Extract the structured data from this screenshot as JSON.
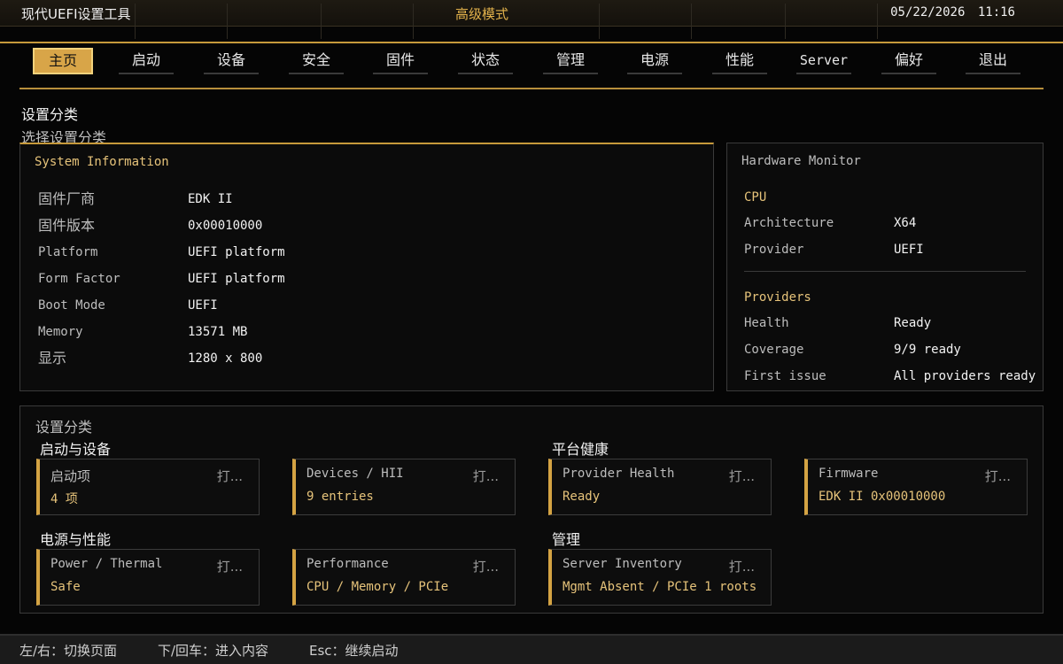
{
  "header": {
    "app_title": "现代UEFI设置工具",
    "mode": "高级模式",
    "date": "05/22/2026",
    "time": "11:16"
  },
  "nav": {
    "tabs": [
      "主页",
      "启动",
      "设备",
      "安全",
      "固件",
      "状态",
      "管理",
      "电源",
      "性能",
      "Server",
      "偏好",
      "退出"
    ],
    "active": "主页"
  },
  "page": {
    "title": "设置分类",
    "subtitle": "选择设置分类"
  },
  "system_info": {
    "title": "System Information",
    "rows": [
      {
        "key": "固件厂商",
        "value": "EDK II"
      },
      {
        "key": "固件版本",
        "value": "0x00010000"
      },
      {
        "key": "Platform",
        "value": "UEFI platform"
      },
      {
        "key": "Form Factor",
        "value": "UEFI platform"
      },
      {
        "key": "Boot Mode",
        "value": "UEFI"
      },
      {
        "key": "Memory",
        "value": "13571 MB"
      },
      {
        "key": "显示",
        "value": "1280 x 800"
      }
    ]
  },
  "hardware_monitor": {
    "title": "Hardware Monitor",
    "cpu_section": "CPU",
    "cpu_rows": [
      {
        "key": "Architecture",
        "value": "X64"
      },
      {
        "key": "Provider",
        "value": "UEFI"
      }
    ],
    "providers_section": "Providers",
    "provider_rows": [
      {
        "key": "Health",
        "value": "Ready"
      },
      {
        "key": "Coverage",
        "value": "9/9 ready"
      },
      {
        "key": "First issue",
        "value": "All providers ready"
      }
    ]
  },
  "categories": {
    "title": "设置分类",
    "open_label": "打...",
    "groups": [
      {
        "label": "启动与设备",
        "cards": [
          {
            "title": "启动项",
            "value": "4 项"
          },
          {
            "title": "Devices / HII",
            "value": "9 entries"
          }
        ]
      },
      {
        "label": "平台健康",
        "cards": [
          {
            "title": "Provider Health",
            "value": "Ready"
          },
          {
            "title": "Firmware",
            "value": "EDK II 0x00010000"
          }
        ]
      },
      {
        "label": "电源与性能",
        "cards": [
          {
            "title": "Power / Thermal",
            "value": "Safe"
          },
          {
            "title": "Performance",
            "value": "CPU / Memory / PCIe"
          }
        ]
      },
      {
        "label": "管理",
        "cards": [
          {
            "title": "Server Inventory",
            "value": "Mgmt Absent / PCIe 1 roots"
          }
        ]
      }
    ]
  },
  "footer": {
    "hint_1": "左/右：切换页面",
    "hint_2": "下/回车：进入内容",
    "hint_3": "Esc：继续启动"
  },
  "colors": {
    "accent": "#d4a343",
    "accent_text": "#e6c37a",
    "background": "#050505"
  }
}
